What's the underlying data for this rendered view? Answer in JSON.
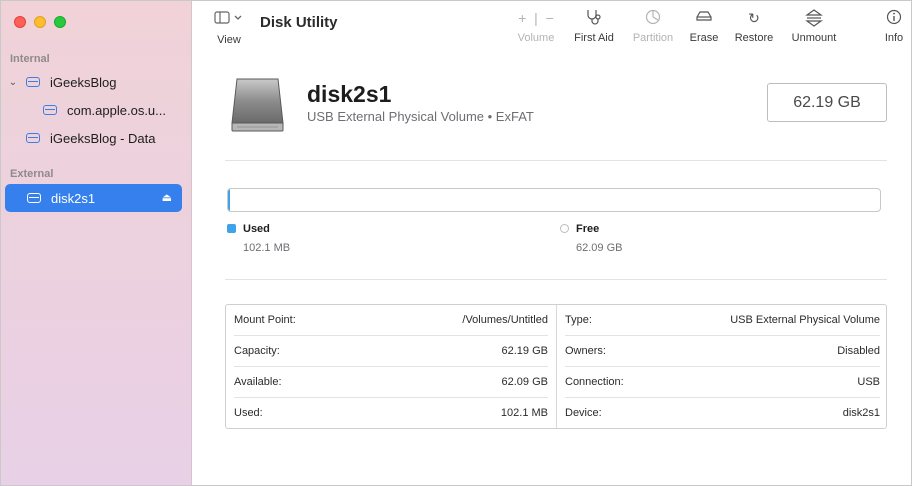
{
  "window": {
    "title": "Disk Utility"
  },
  "sidebar": {
    "internal_label": "Internal",
    "external_label": "External",
    "items": [
      {
        "label": "iGeeksBlog"
      },
      {
        "label": "com.apple.os.u..."
      },
      {
        "label": "iGeeksBlog - Data"
      },
      {
        "label": "disk2s1"
      }
    ]
  },
  "toolbar": {
    "view_label": "View",
    "buttons": [
      {
        "label": "Volume",
        "enabled": false
      },
      {
        "label": "First Aid",
        "enabled": true
      },
      {
        "label": "Partition",
        "enabled": false
      },
      {
        "label": "Erase",
        "enabled": true
      },
      {
        "label": "Restore",
        "enabled": true
      },
      {
        "label": "Unmount",
        "enabled": true
      },
      {
        "label": "Info",
        "enabled": true
      }
    ]
  },
  "disk": {
    "name": "disk2s1",
    "subtitle": "USB External Physical Volume • ExFAT",
    "capacity": "62.19 GB"
  },
  "usage": {
    "used_label": "Used",
    "used_value": "102.1 MB",
    "free_label": "Free",
    "free_value": "62.09 GB",
    "used_fraction": 0.0016,
    "used_color": "#3ea3e9"
  },
  "info": {
    "left": [
      {
        "key": "Mount Point:",
        "value": "/Volumes/Untitled"
      },
      {
        "key": "Capacity:",
        "value": "62.19 GB"
      },
      {
        "key": "Available:",
        "value": "62.09 GB"
      },
      {
        "key": "Used:",
        "value": "102.1 MB"
      }
    ],
    "right": [
      {
        "key": "Type:",
        "value": "USB External Physical Volume"
      },
      {
        "key": "Owners:",
        "value": "Disabled"
      },
      {
        "key": "Connection:",
        "value": "USB"
      },
      {
        "key": "Device:",
        "value": "disk2s1"
      }
    ]
  }
}
